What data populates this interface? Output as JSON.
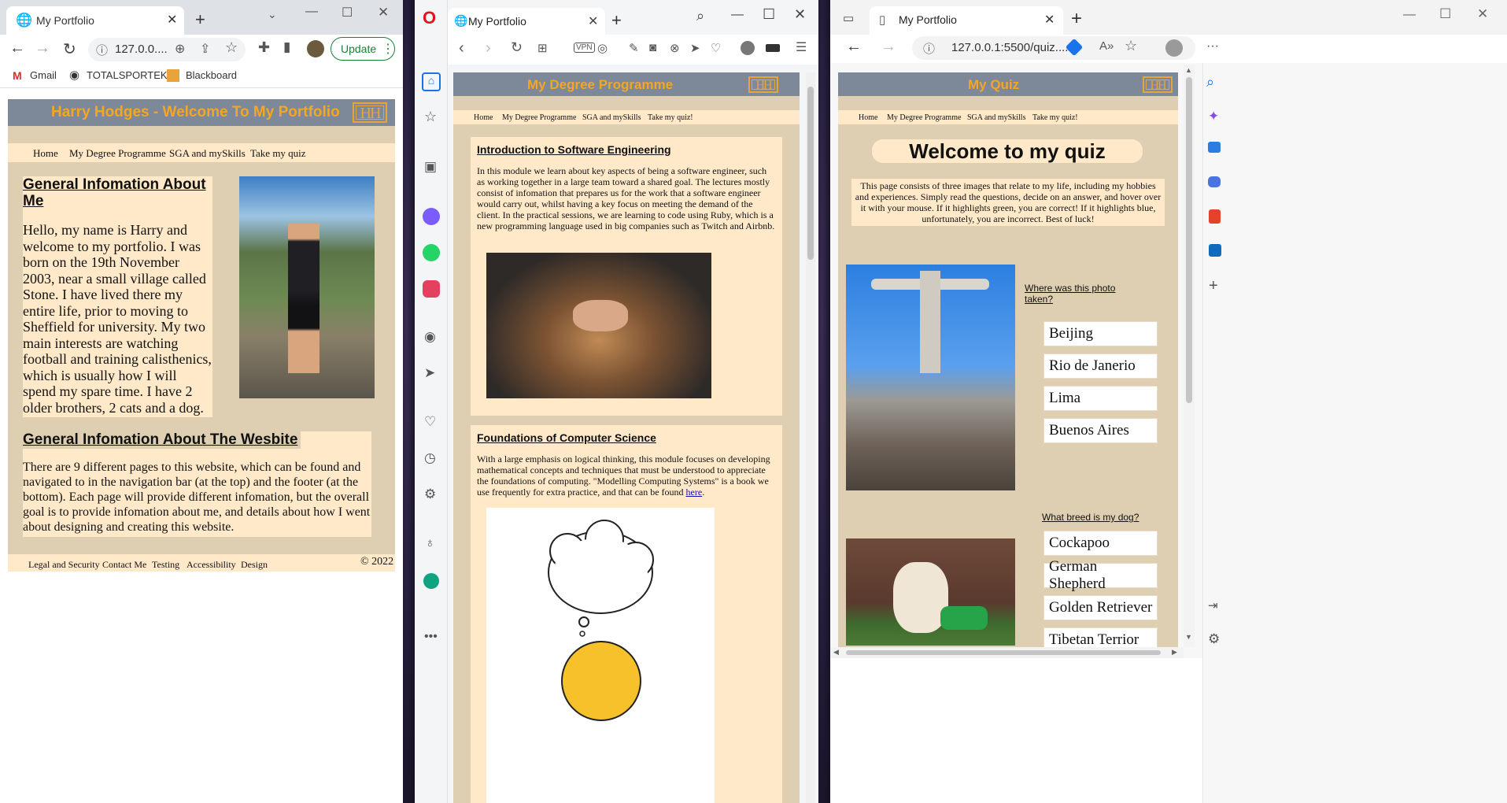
{
  "chrome": {
    "tab_title": "My Portfolio",
    "address": "127.0.0....",
    "update_label": "Update",
    "bookmarks": [
      "Gmail",
      "TOTALSPORTEK",
      "Blackboard"
    ]
  },
  "opera": {
    "tab_title": "My Portfolio",
    "vpn_label": "VPN"
  },
  "edge": {
    "tab_title": "My Portfolio",
    "address": "127.0.0.1:5500/quiz...."
  },
  "site": {
    "initials": "HH",
    "nav": [
      "Home",
      "My Degree Programme",
      "SGA and mySkills",
      "Take my quiz"
    ],
    "nav_small": [
      "Home",
      "My Degree Programme",
      "SGA and mySkills",
      "Take my quiz!"
    ]
  },
  "portfolio": {
    "banner": "Harry Hodges - Welcome To My Portfolio",
    "about_heading": "General Infomation About Me",
    "about_text": "Hello, my name is Harry and welcome to my portfolio. I was born on the 19th November 2003, near a small village called Stone. I have lived there my entire life, prior to moving to Sheffield for university. My two main interests are watching football and training calisthenics, which is usually how I will spend my spare time. I have 2 older brothers, 2 cats and a dog.",
    "website_heading": "General Infomation About The Wesbite",
    "website_text": "There are 9 different pages to this website, which can be found and navigated to in the navigation bar (at the top) and the footer (at the bottom). Each page will provide different infomation, but the overall goal is to provide infomation about me, and details about how I went about designing and creating this website.",
    "footer_links": [
      "Legal and Security",
      "Contact Me",
      "Testing",
      "Accessibility",
      "Design"
    ],
    "copyright": "© 2022"
  },
  "degree": {
    "banner": "My Degree Programme",
    "se_heading": "Introduction to Software Engineering",
    "se_text": "In this module we learn about key aspects of being a software engineer, such as working together in a large team toward a shared goal. The lectures mostly consist of infomation that prepares us for the work that a software engineer would carry out, whilst having a key focus on meeting the demand of the client. In the practical sessions, we are learning to code using Ruby, which is a new programming language used in big companies such as Twitch and Airbnb.",
    "cs_heading": "Foundations of Computer Science",
    "cs_text": "With a large emphasis on logical thinking, this module focuses on developing mathematical concepts and techniques that must be understood to appreciate the foundations of computing. \"Modelling Computing Systems\" is a book we use frequently for extra practice, and that can be found",
    "cs_link": "here"
  },
  "quiz": {
    "banner": "My Quiz",
    "title": "Welcome to my quiz",
    "intro": "This page consists of three images that relate to my life, including my hobbies and experiences. Simply read the questions, decide on an answer, and hover over it with your mouse. If it highlights green, you are correct! If it highlights blue, unfortunately, you are incorrect. Best of luck!",
    "q1": "Where was this photo taken?",
    "q1_options": [
      "Beijing",
      "Rio de Janerio",
      "Lima",
      "Buenos Aires"
    ],
    "q2": "What breed is my dog?",
    "q2_options": [
      "Cockapoo",
      "German Shepherd",
      "Golden Retriever",
      "Tibetan Terrior"
    ]
  },
  "colors": {
    "banner_bg": "#7d8899",
    "banner_text": "#f5a623",
    "page_bg": "#dfcfb2",
    "panel_bg": "#ffe9c9"
  }
}
